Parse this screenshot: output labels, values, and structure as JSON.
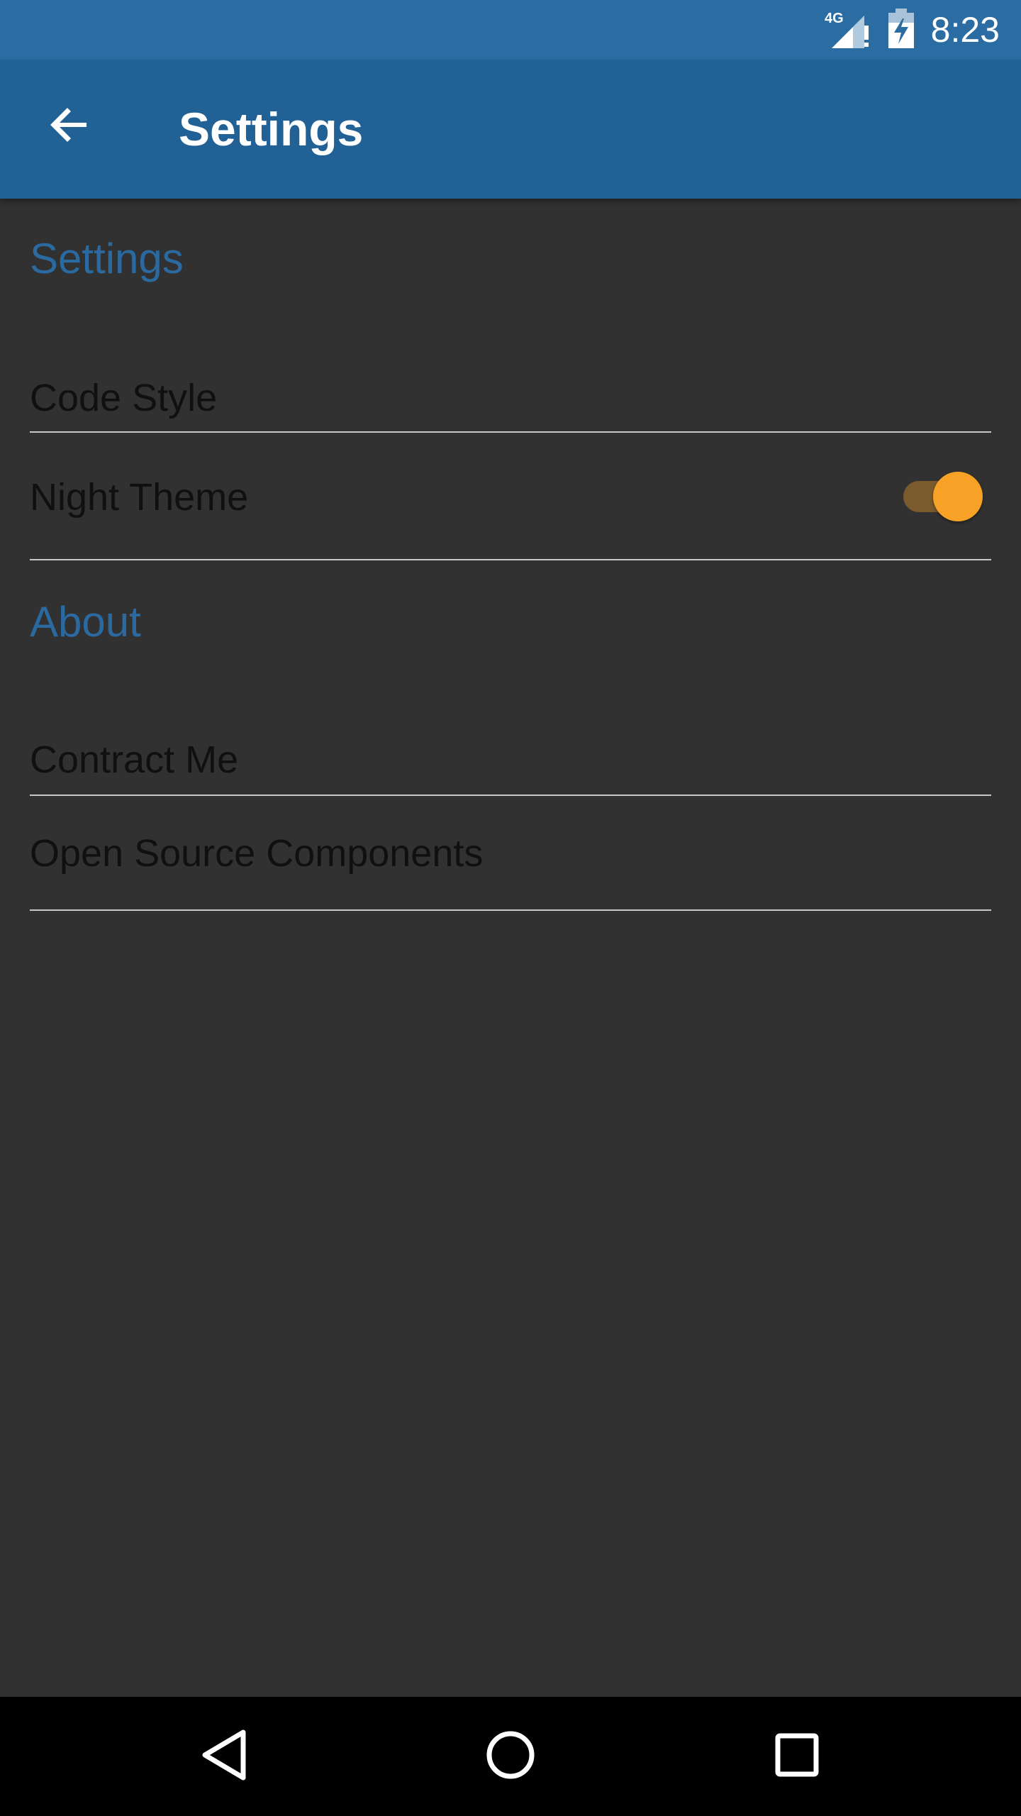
{
  "status_bar": {
    "network_label": "4G",
    "time": "8:23"
  },
  "app_bar": {
    "title": "Settings",
    "back_icon": "arrow-back-icon"
  },
  "sections": [
    {
      "header": "Settings",
      "items": [
        {
          "label": "Code Style"
        },
        {
          "label": "Night Theme",
          "toggle": true,
          "toggle_on": true
        }
      ]
    },
    {
      "header": "About",
      "items": [
        {
          "label": "Contract Me"
        },
        {
          "label": "Open Source Components"
        }
      ]
    }
  ],
  "nav_bar": {
    "back_icon": "nav-back-icon",
    "home_icon": "nav-home-icon",
    "recents_icon": "nav-recents-icon"
  },
  "colors": {
    "status_bar": "#2b6da2",
    "app_bar": "#216195",
    "background": "#313131",
    "section_header": "#2a6aa0",
    "toggle_thumb": "#f7a227",
    "toggle_track": "#7b5a2d"
  }
}
